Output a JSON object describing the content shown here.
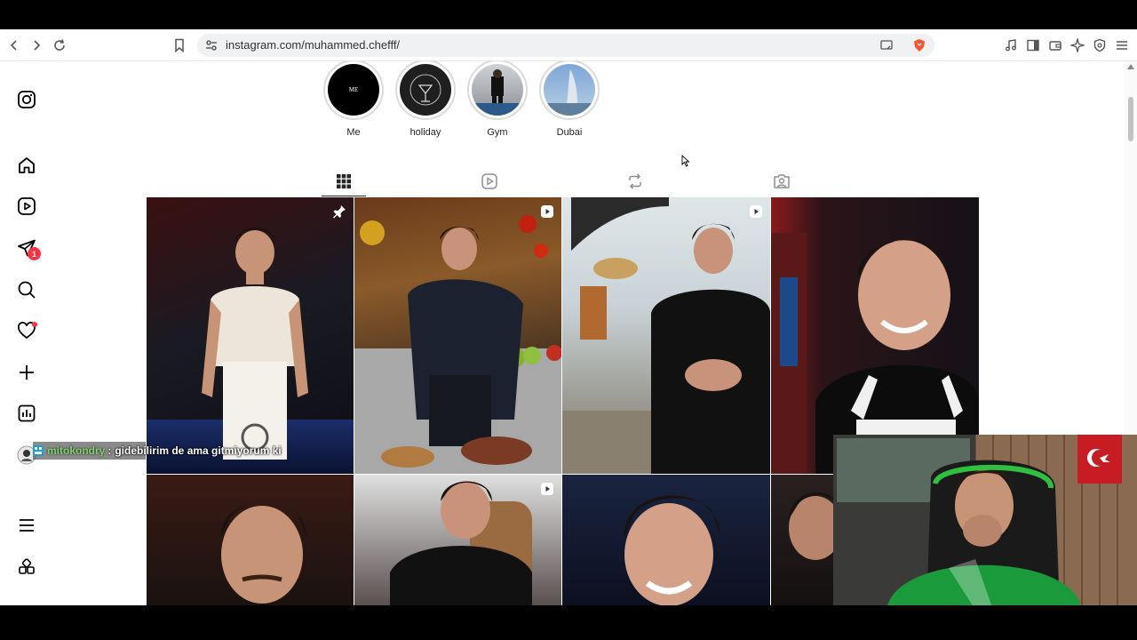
{
  "browser": {
    "url": "instagram.com/muhammed.chefff/"
  },
  "sidebar": {
    "items": [
      {
        "name": "instagram-logo-icon"
      },
      {
        "name": "home-icon"
      },
      {
        "name": "reels-icon"
      },
      {
        "name": "messages-icon",
        "badge": "1"
      },
      {
        "name": "search-icon"
      },
      {
        "name": "notifications-icon"
      },
      {
        "name": "create-icon"
      },
      {
        "name": "dashboard-icon"
      },
      {
        "name": "profile-avatar"
      },
      {
        "name": "menu-icon"
      },
      {
        "name": "also-from-meta-icon"
      }
    ]
  },
  "highlights": [
    {
      "label": "Me",
      "cover_text": "ME"
    },
    {
      "label": "holiday"
    },
    {
      "label": "Gym"
    },
    {
      "label": "Dubai"
    }
  ],
  "tabs": [
    "posts",
    "reels",
    "reposts",
    "tagged"
  ],
  "chat": {
    "user": "mitokondry",
    "separator": ":",
    "message": "gidebilirim de ama gitmiyorum ki"
  },
  "colors": {
    "accent": "#ff3040",
    "brave": "#fb542b"
  }
}
